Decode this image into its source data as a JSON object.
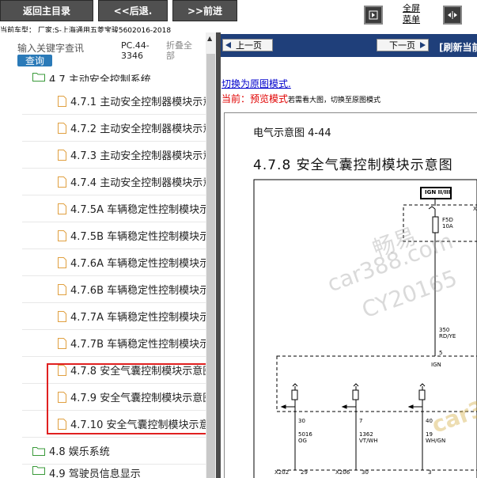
{
  "toolbar": {
    "back_home": "返回主目录",
    "prev": "<<后退.",
    "next": ">>前进",
    "fullscreen_line1": "全屏",
    "fullscreen_line2": "菜单"
  },
  "car_info": "当前车型： 厂家:S-上海通用五菱宝骏5602016-2018",
  "search": {
    "placeholder": "输入关键字查讯",
    "query_button": "查询",
    "pc_line1": "PC.44-",
    "pc_line2": "3346",
    "fold_line1": "折叠全",
    "fold_line2": "部"
  },
  "tree": {
    "partial_top": "4.7 主动安全控制系统",
    "items": [
      "4.7.1 主动安全控制器模块示意图",
      "4.7.2 主动安全控制器模块示意图",
      "4.7.3 主动安全控制器模块示意图",
      "4.7.4 主动安全控制器模块示意图",
      "4.7.5A 车辆稳定性控制模块示意图",
      "4.7.5B 车辆稳定性控制模块示意图",
      "4.7.6A 车辆稳定性控制模块示意图",
      "4.7.6B 车辆稳定性控制模块示意图",
      "4.7.7A 车辆稳定性控制模块示意图",
      "4.7.7B 车辆稳定性控制模块示意图",
      "4.7.8 安全气囊控制模块示意图",
      "4.7.9 安全气囊控制模块示意图",
      "4.7.10 安全气囊控制模块示意图"
    ],
    "folder_entertainment": "4.8 娱乐系统",
    "partial_bottom": "4.9 驾驶员信息显示"
  },
  "viewer": {
    "prev_page": "上一页",
    "next_page": "下一页",
    "refresh": "[刷新当前",
    "switch_link": "切换为原图模式.",
    "mode_prefix": "当前：",
    "mode_name": "预览模式",
    "mode_hint": "若需看大图，切换至原图模式",
    "doc_label": "电气示意图 4-44",
    "doc_title": "4.7.8 安全气囊控制模块示意图"
  },
  "schematic": {
    "ign_box": "IGN II/III",
    "fuse_name": "F5D",
    "fuse_rating": "10A",
    "wire_350": "350",
    "wire_350_color": "RD/YE",
    "pin_5": "5",
    "ign_label": "IGN",
    "pin_30": "30",
    "wire_5016": "5016",
    "wire_5016_color": "OG",
    "pin_7": "7",
    "wire_1362": "1362",
    "wire_1362_color": "VT/WH",
    "pin_40": "40",
    "wire_19": "19",
    "wire_19_color": "WH/GN",
    "conn_x202": "X202",
    "conn_x202_pin": "29",
    "conn_x206": "X206",
    "conn_x206_pin": "30",
    "conn_pin_3": "3",
    "side_x": "X"
  },
  "watermark": {
    "line1": "畅易",
    "line2": "car388.com",
    "line3": "CY20165",
    "corner": "car3"
  },
  "colors": {
    "nav_button": "#505050",
    "toolbar_blue": "#1f3f7a",
    "highlight_red": "#e02020",
    "query_blue": "#2a7ab8",
    "mode_red": "#e00000"
  }
}
